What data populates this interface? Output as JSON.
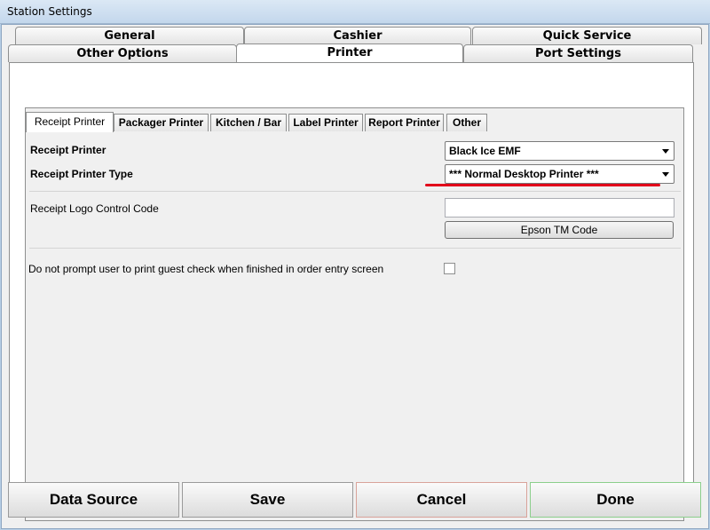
{
  "window": {
    "title": "Station Settings"
  },
  "tabs": {
    "row1": [
      "General",
      "Cashier",
      "Quick Service"
    ],
    "row2": [
      "Other Options",
      "Printer",
      "Port Settings"
    ],
    "active": "Printer"
  },
  "subtabs": {
    "items": [
      "Receipt Printer",
      "Packager Printer",
      "Kitchen / Bar",
      "Label Printer",
      "Report Printer",
      "Other"
    ],
    "active": "Receipt Printer"
  },
  "form": {
    "receipt_printer_label": "Receipt Printer",
    "receipt_printer_value": "Black Ice EMF",
    "receipt_printer_type_label": "Receipt Printer Type",
    "receipt_printer_type_value": "*** Normal Desktop Printer ***",
    "logo_code_label": "Receipt Logo Control Code",
    "logo_code_value": "",
    "epson_button": "Epson TM Code",
    "no_prompt_label": "Do not prompt user to print guest check when finished in order entry screen",
    "no_prompt_checked": false
  },
  "footer": {
    "data_source": "Data Source",
    "save": "Save",
    "cancel": "Cancel",
    "done": "Done"
  },
  "colors": {
    "highlight_underline": "#e2001a",
    "cancel_border": "#d9a39a",
    "done_border": "#8ccf8c"
  }
}
